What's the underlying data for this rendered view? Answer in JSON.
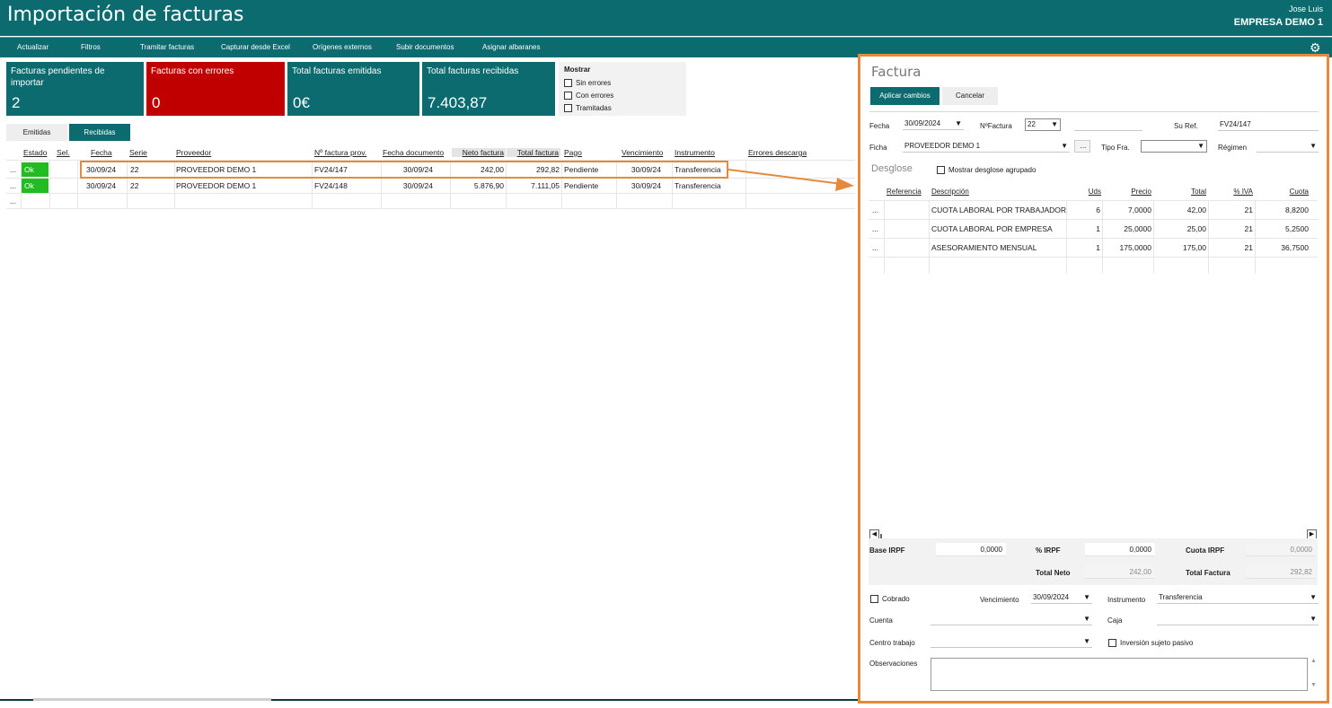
{
  "header": {
    "title": "Importación de facturas",
    "user": "Jose Luis",
    "company": "EMPRESA DEMO 1"
  },
  "toolbar": {
    "items": [
      "Actualizar",
      "Filtros",
      "Tramitar facturas",
      "Capturar desde Excel",
      "Orígenes externos",
      "Subir documentos",
      "Asignar albaranes"
    ],
    "settings_icon": "gear-icon"
  },
  "tiles": [
    {
      "label": "Facturas pendientes de importar",
      "value": "2",
      "color": "#0b6b6f"
    },
    {
      "label": "Facturas con errores",
      "value": "0",
      "color": "#c00000"
    },
    {
      "label": "Total facturas emitidas",
      "value": "0€",
      "color": "#0b6b6f"
    },
    {
      "label": "Total facturas recibidas",
      "value": "7.403,87",
      "color": "#0b6b6f"
    }
  ],
  "show_filter": {
    "title": "Mostrar",
    "options": [
      "Sin errores",
      "Con errores",
      "Tramitadas"
    ]
  },
  "tabs": {
    "emitidas": "Emitidas",
    "recibidas": "Recibidas",
    "active": "Recibidas"
  },
  "grid": {
    "columns": [
      "Estado",
      "Sel.",
      "Fecha",
      "Serie",
      "Proveedor",
      "Nº factura prov.",
      "Fecha documento",
      "Neto factura",
      "Total factura",
      "Pago",
      "Vencimiento",
      "Instrumento",
      "Errores descarga"
    ],
    "rows": [
      {
        "more": "...",
        "estado": "Ok",
        "fecha": "30/09/24",
        "serie": "22",
        "proveedor": "PROVEEDOR DEMO 1",
        "num": "FV24/147",
        "fecha_doc": "30/09/24",
        "neto": "242,00",
        "total": "292,82",
        "pago": "Pendiente",
        "venc": "30/09/24",
        "instr": "Transferencia"
      },
      {
        "more": "...",
        "estado": "Ok",
        "fecha": "30/09/24",
        "serie": "22",
        "proveedor": "PROVEEDOR DEMO 1",
        "num": "FV24/148",
        "fecha_doc": "30/09/24",
        "neto": "5.876,90",
        "total": "7.111,05",
        "pago": "Pendiente",
        "venc": "30/09/24",
        "instr": "Transferencia"
      }
    ],
    "new_row_more": "..."
  },
  "invoice": {
    "title": "Factura",
    "apply": "Aplicar cambios",
    "cancel": "Cancelar",
    "fecha_label": "Fecha",
    "fecha": "30/09/2024",
    "nfactura_label": "NºFactura",
    "nfactura": "22",
    "suref_label": "Su Ref.",
    "suref": "FV24/147",
    "ficha_label": "Ficha",
    "ficha": "PROVEEDOR DEMO 1",
    "ficha_more": "...",
    "tipofra_label": "Tipo Fra.",
    "regimen_label": "Régimen",
    "desglose_label": "Desglose",
    "mostrar_agrupado": "Mostrar desglose agrupado",
    "lines_columns": [
      "Referencia",
      "Descripción",
      "Uds",
      "Precio",
      "Total",
      "% IVA",
      "Cuota"
    ],
    "lines": [
      {
        "more": "...",
        "ref": "",
        "desc": "CUOTA LABORAL POR TRABAJADOR",
        "uds": "6",
        "precio": "7,0000",
        "total": "42,00",
        "iva": "21",
        "cuota": "8,8200"
      },
      {
        "more": "...",
        "ref": "",
        "desc": "CUOTA LABORAL POR EMPRESA",
        "uds": "1",
        "precio": "25,0000",
        "total": "25,00",
        "iva": "21",
        "cuota": "5,2500"
      },
      {
        "more": "...",
        "ref": "",
        "desc": "ASESORAMIENTO MENSUAL",
        "uds": "1",
        "precio": "175,0000",
        "total": "175,00",
        "iva": "21",
        "cuota": "36,7500"
      }
    ],
    "base_irpf_label": "Base IRPF",
    "base_irpf": "0,0000",
    "pct_irpf_label": "% IRPF",
    "pct_irpf": "0,0000",
    "cuota_irpf_label": "Cuota IRPF",
    "cuota_irpf": "0,0000",
    "total_neto_label": "Total Neto",
    "total_neto": "242,00",
    "total_factura_label": "Total Factura",
    "total_factura": "292,82",
    "cobrado_label": "Cobrado",
    "vencimiento_label": "Vencimiento",
    "vencimiento": "30/09/2024",
    "instrumento_label": "Instrumento",
    "instrumento": "Transferencia",
    "cuenta_label": "Cuenta",
    "caja_label": "Caja",
    "centro_label": "Centro trabajo",
    "inversion_label": "Inversión sujeto pasivo",
    "observaciones_label": "Observaciones"
  },
  "colors": {
    "accent": "#0b6b6f",
    "error": "#c00000",
    "ok": "#22bb22",
    "highlight": "#e58a3a"
  }
}
